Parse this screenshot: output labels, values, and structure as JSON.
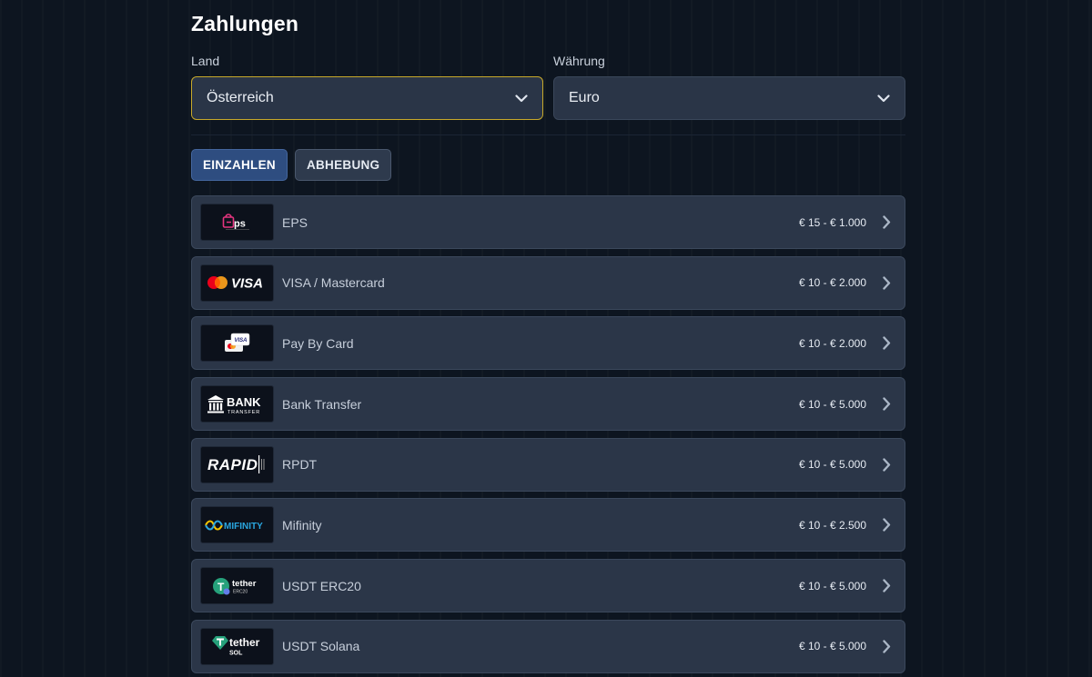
{
  "page": {
    "title": "Zahlungen"
  },
  "filters": {
    "country": {
      "label": "Land",
      "value": "Österreich"
    },
    "currency": {
      "label": "Währung",
      "value": "Euro"
    }
  },
  "tabs": [
    {
      "label": "EINZAHLEN",
      "active": true
    },
    {
      "label": "ABHEBUNG",
      "active": false
    }
  ],
  "methods": [
    {
      "name": "EPS",
      "range": "€ 15 - € 1.000",
      "logo_icon": "eps-logo"
    },
    {
      "name": "VISA / Mastercard",
      "range": "€ 10 - € 2.000",
      "logo_icon": "visa-mastercard-logo",
      "logo_text": "VISA"
    },
    {
      "name": "Pay By Card",
      "range": "€ 10 - € 2.000",
      "logo_icon": "pay-by-card-logo",
      "logo_text": "VISA"
    },
    {
      "name": "Bank Transfer",
      "range": "€ 10 - € 5.000",
      "logo_icon": "bank-transfer-logo",
      "logo_text": "BANK",
      "logo_subtext": "TRANSFER"
    },
    {
      "name": "RPDT",
      "range": "€ 10 - € 5.000",
      "logo_icon": "rapid-logo",
      "logo_text": "RAPID"
    },
    {
      "name": "Mifinity",
      "range": "€ 10 - € 2.500",
      "logo_icon": "mifinity-logo",
      "logo_text": "MIFINITY"
    },
    {
      "name": "USDT ERC20",
      "range": "€ 10 - € 5.000",
      "logo_icon": "tether-erc20-logo",
      "logo_text": "tether",
      "logo_subtext": "ERC20"
    },
    {
      "name": "USDT Solana",
      "range": "€ 10 - € 5.000",
      "logo_icon": "tether-sol-logo",
      "logo_text": "tether",
      "logo_subtext": "SOL"
    }
  ],
  "colors": {
    "background": "#0d1520",
    "card": "#2b3648",
    "active_border": "#c8a92a",
    "primary_tab": "#2e4d80"
  }
}
